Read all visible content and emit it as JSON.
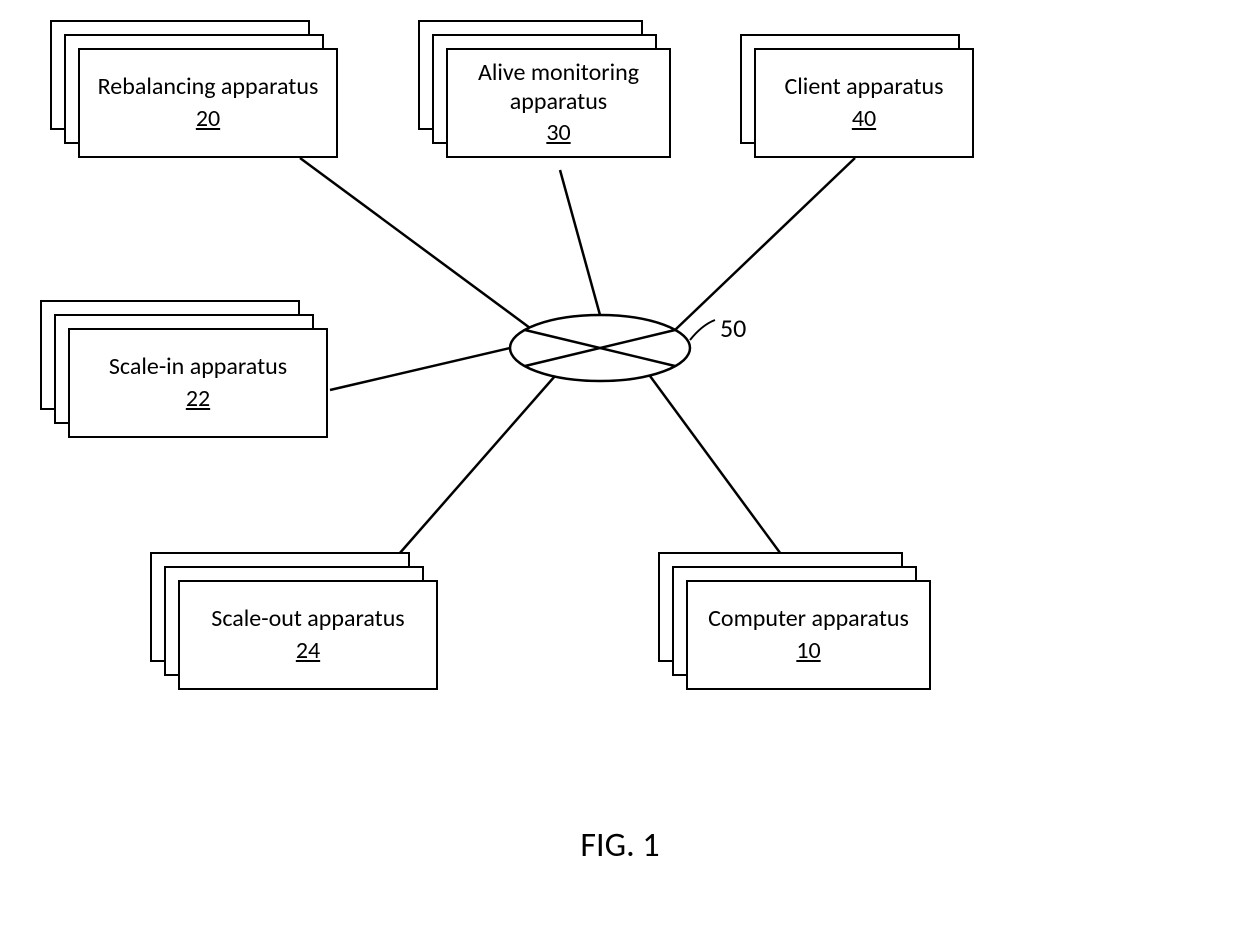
{
  "boxes": {
    "rebalancing": {
      "label": "Rebalancing apparatus",
      "ref": "20"
    },
    "alive_monitoring": {
      "label": "Alive monitoring apparatus",
      "ref": "30"
    },
    "client": {
      "label": "Client apparatus",
      "ref": "40"
    },
    "scale_in": {
      "label": "Scale-in apparatus",
      "ref": "22"
    },
    "scale_out": {
      "label": "Scale-out apparatus",
      "ref": "24"
    },
    "computer": {
      "label": "Computer apparatus",
      "ref": "10"
    }
  },
  "hub_ref": "50",
  "figure_caption": "FIG. 1"
}
